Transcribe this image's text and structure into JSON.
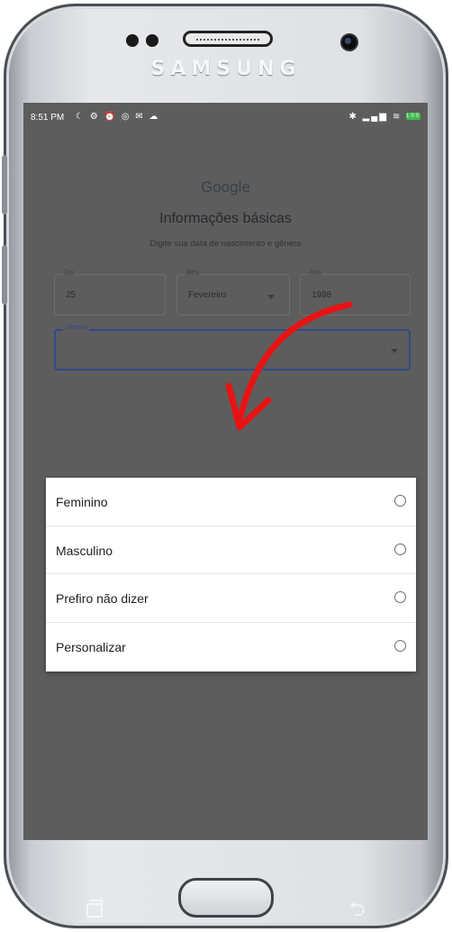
{
  "device": {
    "brand": "SAMSUNG"
  },
  "status_bar": {
    "time": "8:51 PM",
    "left_icons": [
      "moon-icon",
      "gear-icon",
      "alarm-icon",
      "whatsapp-icon",
      "mail-icon",
      "cloud-icon"
    ],
    "right_icons": [
      "bluetooth-icon",
      "signal-icon",
      "wifi-icon",
      "battery-icon"
    ],
    "left_icons_glyphs": "☾ ⚙ ⏰ ◎ ✉ ☁",
    "right_icons_glyphs": "✱ ▂▄▆ ≋",
    "battery_level": "100"
  },
  "page": {
    "logo": "Google",
    "title": "Informações básicas",
    "subtitle": "Digite sua data de nascimento e gênero"
  },
  "birth_date": {
    "day_label": "Dia",
    "day_value": "25",
    "month_label": "Mês",
    "month_value": "Fevereiro",
    "year_label": "Ano",
    "year_value": "1998"
  },
  "gender": {
    "label": "Gênero",
    "value": ""
  },
  "gender_options": [
    {
      "label": "Feminino",
      "selected": false
    },
    {
      "label": "Masculino",
      "selected": false
    },
    {
      "label": "Prefiro não dizer",
      "selected": false
    },
    {
      "label": "Personalizar",
      "selected": false
    }
  ],
  "annotation": {
    "arrow_color": "#e81313"
  },
  "nav": {
    "back_glyph": "⮌"
  }
}
